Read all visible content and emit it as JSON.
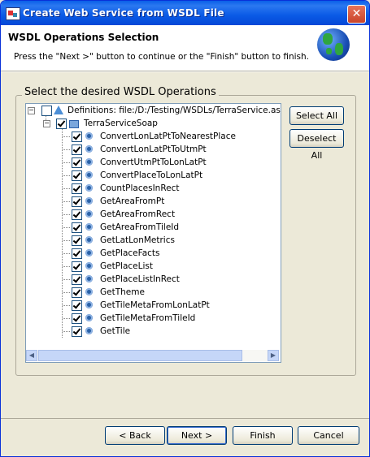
{
  "window": {
    "title": "Create Web Service from WSDL File",
    "close": "✕"
  },
  "header": {
    "title": "WSDL Operations Selection",
    "message": "Press the \"Next >\" button to continue or the \"Finish\" button to finish."
  },
  "group": {
    "label": "Select the desired WSDL Operations"
  },
  "tree": {
    "definitions": "Definitions: file:/D:/Testing/WSDLs/TerraService.asmx",
    "service": "TerraServiceSoap",
    "operations": [
      "ConvertLonLatPtToNearestPlace",
      "ConvertLonLatPtToUtmPt",
      "ConvertUtmPtToLonLatPt",
      "ConvertPlaceToLonLatPt",
      "CountPlacesInRect",
      "GetAreaFromPt",
      "GetAreaFromRect",
      "GetAreaFromTileId",
      "GetLatLonMetrics",
      "GetPlaceFacts",
      "GetPlaceList",
      "GetPlaceListInRect",
      "GetTheme",
      "GetTileMetaFromLonLatPt",
      "GetTileMetaFromTileId",
      "GetTile"
    ]
  },
  "side_buttons": {
    "select_all": "Select All",
    "deselect_all": "Deselect All"
  },
  "footer": {
    "back": "< Back",
    "next": "Next >",
    "finish": "Finish",
    "cancel": "Cancel"
  }
}
